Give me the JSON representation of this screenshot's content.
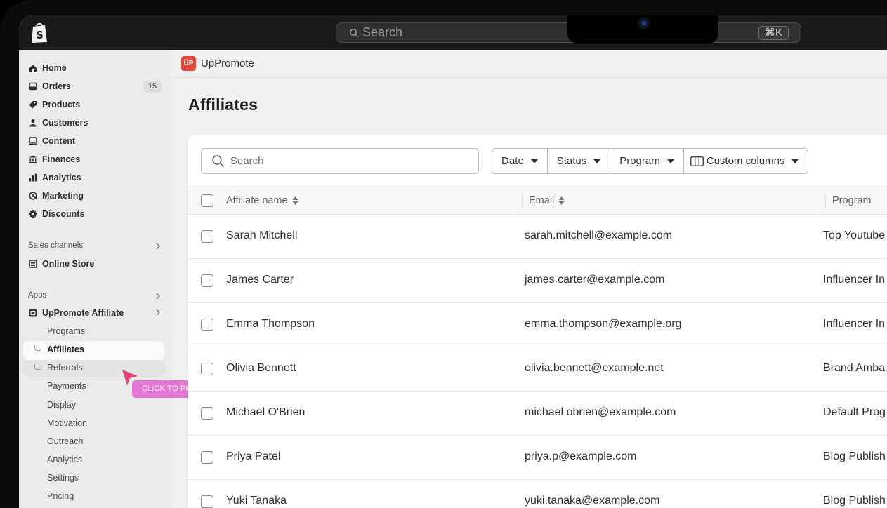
{
  "topbar": {
    "search_placeholder": "Search",
    "shortcut": "⌘K"
  },
  "sidebar": {
    "items": [
      {
        "label": "Home",
        "icon": "home-icon"
      },
      {
        "label": "Orders",
        "icon": "orders-icon",
        "badge": "15"
      },
      {
        "label": "Products",
        "icon": "tag-icon"
      },
      {
        "label": "Customers",
        "icon": "person-icon"
      },
      {
        "label": "Content",
        "icon": "content-icon"
      },
      {
        "label": "Finances",
        "icon": "bank-icon"
      },
      {
        "label": "Analytics",
        "icon": "bar-chart-icon"
      },
      {
        "label": "Marketing",
        "icon": "target-icon"
      },
      {
        "label": "Discounts",
        "icon": "discount-icon"
      }
    ],
    "sales_channels_label": "Sales channels",
    "online_store": "Online Store",
    "apps_label": "Apps",
    "app_name": "UpPromote Affiliate",
    "app_subitems": [
      "Programs",
      "Affiliates",
      "Referrals",
      "Payments",
      "Display",
      "Motivation",
      "Outreach",
      "Analytics",
      "Settings",
      "Pricing"
    ],
    "active_subitem": "Affiliates"
  },
  "preview_pill": "CLICK TO PREVIEW",
  "app_header": {
    "logo_text": "ÜP",
    "name": "UpPromote"
  },
  "page_title": "Affiliates",
  "toolbar": {
    "search_placeholder": "Search",
    "filters": [
      "Date",
      "Status",
      "Program",
      "Custom columns"
    ]
  },
  "table": {
    "columns": [
      "Affiliate name",
      "Email",
      "Program"
    ],
    "rows": [
      {
        "name": "Sarah Mitchell",
        "email": "sarah.mitchell@example.com",
        "program": "Top Youtube"
      },
      {
        "name": "James Carter",
        "email": "james.carter@example.com",
        "program": "Influencer In"
      },
      {
        "name": "Emma Thompson",
        "email": "emma.thompson@example.org",
        "program": "Influencer In"
      },
      {
        "name": "Olivia Bennett",
        "email": "olivia.bennett@example.net",
        "program": "Brand Amba"
      },
      {
        "name": "Michael O'Brien",
        "email": "michael.obrien@example.com",
        "program": "Default Prog"
      },
      {
        "name": "Priya Patel",
        "email": "priya.p@example.com",
        "program": "Blog Publish"
      },
      {
        "name": "Yuki Tanaka",
        "email": "yuki.tanaka@example.com",
        "program": "Blog Publish"
      }
    ]
  }
}
